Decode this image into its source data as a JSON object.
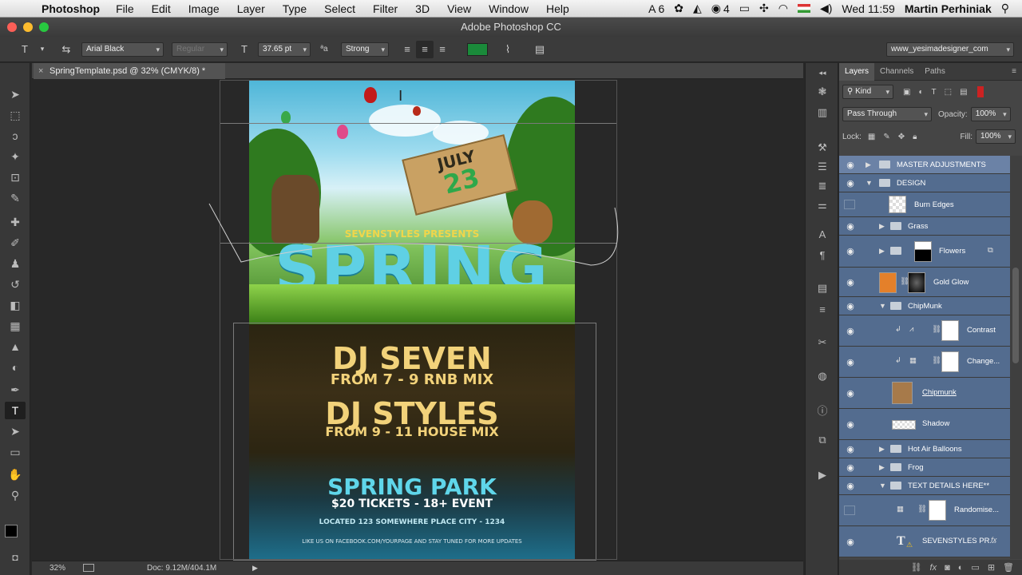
{
  "menubar": {
    "apple": "",
    "app_name": "Photoshop",
    "menus": [
      "File",
      "Edit",
      "Image",
      "Layer",
      "Type",
      "Select",
      "Filter",
      "3D",
      "View",
      "Window",
      "Help"
    ],
    "adobe_count": "6",
    "cc_count": "4",
    "clock": "Wed 11:59",
    "user": "Martin Perhiniak"
  },
  "window": {
    "title": "Adobe Photoshop CC"
  },
  "options": {
    "font_family": "Arial Black",
    "font_style": "Regular",
    "font_size": "37.65 pt",
    "antialias_glyph": "ªa",
    "antialias": "Strong",
    "text_color": "#1a8a3a",
    "workspace": "www_yesimadesigner_com"
  },
  "document": {
    "tab_title": "SpringTemplate.psd @ 32% (CMYK/8) *",
    "close_glyph": "×"
  },
  "poster": {
    "sign_month": "JULY",
    "sign_day": "23",
    "presents": "SEVENSTYLES PRESENTS",
    "spring": "SPRING",
    "dj1": "DJ SEVEN",
    "dj1_sub": "FROM 7 - 9 RNB MIX",
    "dj2": "DJ STYLES",
    "dj2_sub": "FROM 9 - 11 HOUSE MIX",
    "event": "SPRING PARK",
    "tickets": "$20 TICKETS - 18+ EVENT",
    "location": "LOCATED 123 SOMEWHERE PLACE CITY - 1234",
    "facebook": "LIKE US ON FACEBOOK.COM/YOURPAGE AND STAY TUNED FOR MORE UPDATES"
  },
  "status": {
    "zoom": "32%",
    "doc_size": "Doc: 9.12M/404.1M"
  },
  "layers_panel": {
    "tabs": [
      "Layers",
      "Channels",
      "Paths"
    ],
    "filter": "Kind",
    "blend_mode": "Pass Through",
    "opacity_label": "Opacity:",
    "opacity": "100%",
    "lock_label": "Lock:",
    "fill_label": "Fill:",
    "fill": "100%",
    "layers": [
      {
        "name": "MASTER ADJUSTMENTS",
        "type": "group"
      },
      {
        "name": "DESIGN",
        "type": "group"
      },
      {
        "name": "Burn Edges",
        "type": "layer"
      },
      {
        "name": "Grass",
        "type": "group"
      },
      {
        "name": "Flowers",
        "type": "group"
      },
      {
        "name": "Gold Glow",
        "type": "layer"
      },
      {
        "name": "ChipMunk",
        "type": "group"
      },
      {
        "name": "Contrast",
        "type": "adjustment"
      },
      {
        "name": "Change...",
        "type": "adjustment"
      },
      {
        "name": "Chipmunk",
        "type": "layer"
      },
      {
        "name": "Shadow",
        "type": "layer"
      },
      {
        "name": "Hot Air Balloons",
        "type": "group"
      },
      {
        "name": "Frog",
        "type": "group"
      },
      {
        "name": "TEXT DETAILS HERE**",
        "type": "group"
      },
      {
        "name": "Randomise...",
        "type": "adjustment"
      },
      {
        "name": "SEVENSTYLES PR...",
        "type": "text"
      }
    ]
  }
}
